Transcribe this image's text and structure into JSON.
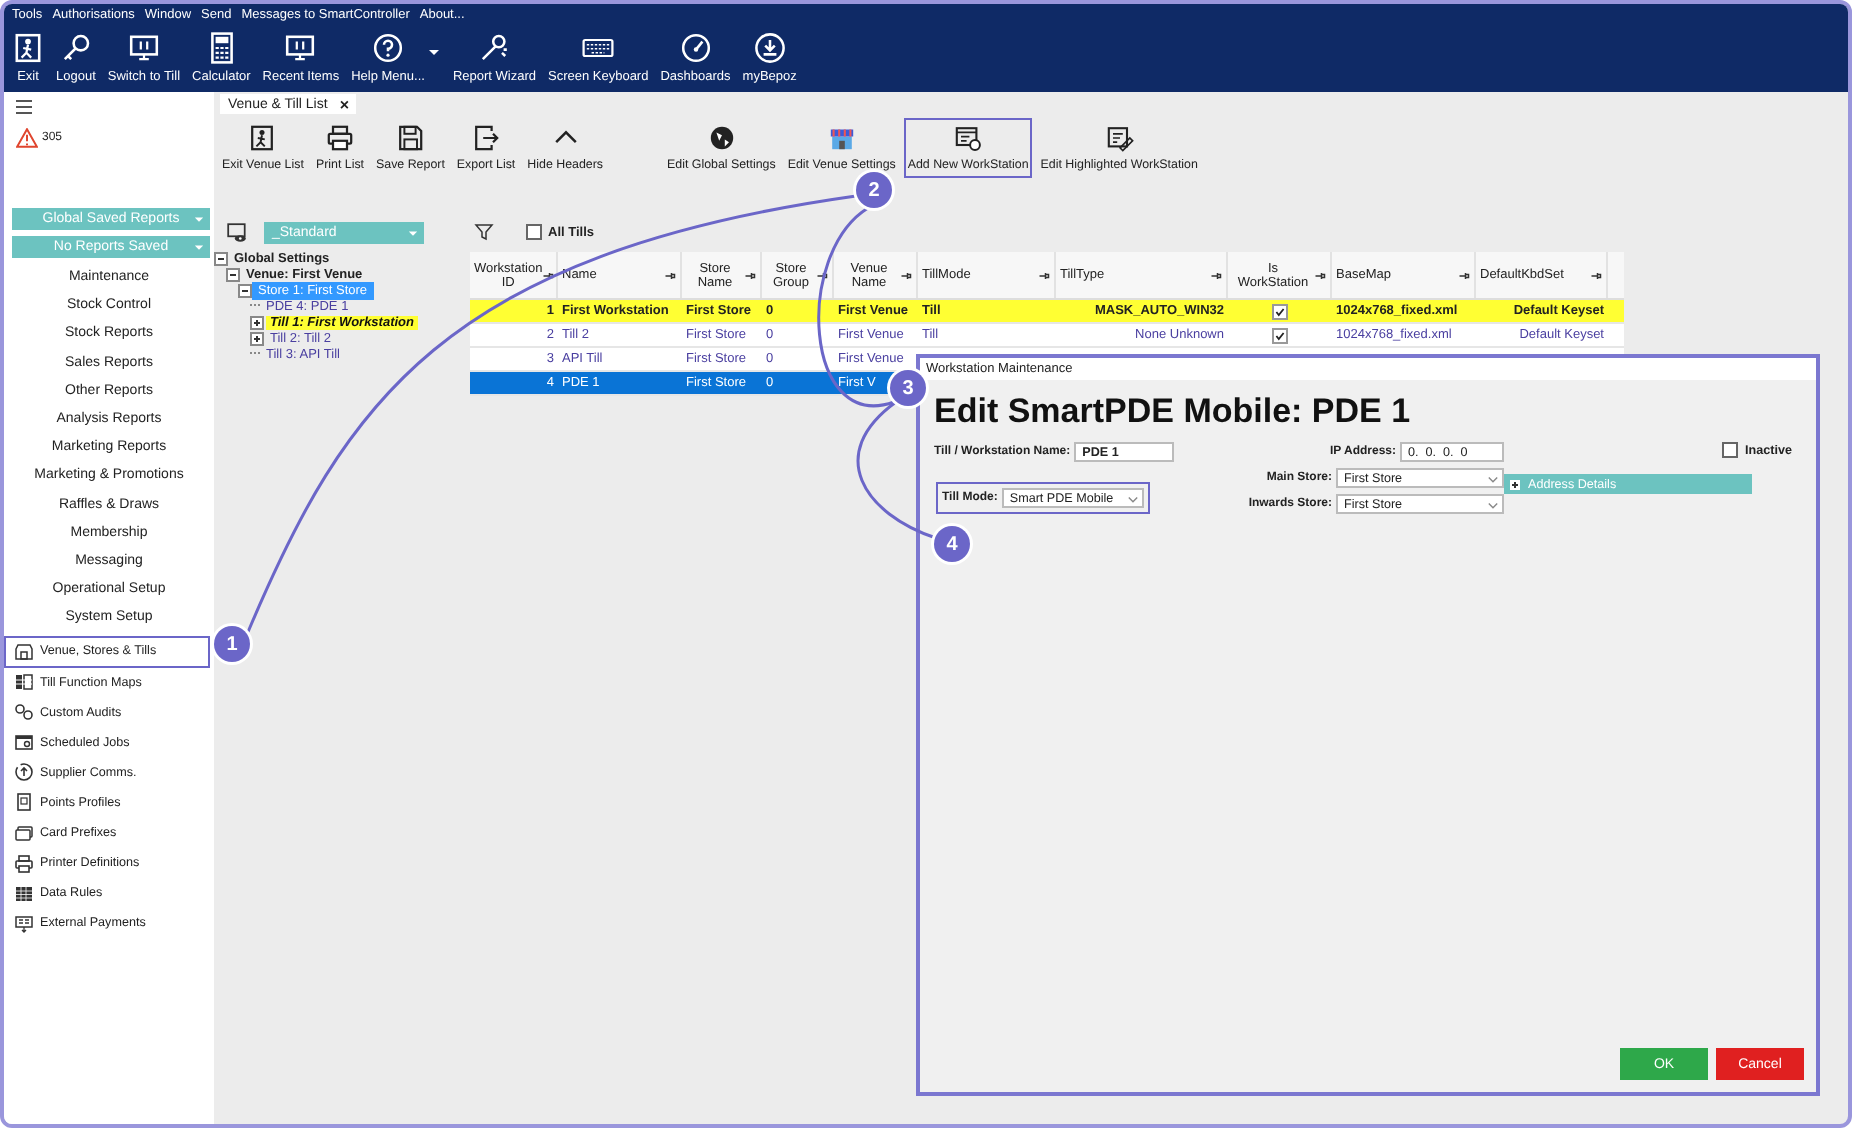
{
  "menu_bar": [
    "Tools",
    "Authorisations",
    "Window",
    "Send",
    "Messages to SmartController",
    "About..."
  ],
  "toolbar": [
    {
      "kind": "button",
      "label": "Exit"
    },
    {
      "kind": "button",
      "label": "Logout"
    },
    {
      "kind": "button",
      "label": "Switch to Till"
    },
    {
      "kind": "button",
      "label": "Calculator"
    },
    {
      "kind": "button",
      "label": "Recent Items"
    },
    {
      "kind": "button",
      "label": "Help Menu..."
    },
    {
      "kind": "caret"
    },
    {
      "kind": "button",
      "label": "Report Wizard"
    },
    {
      "kind": "button",
      "label": "Screen Keyboard"
    },
    {
      "kind": "button",
      "label": "Dashboards"
    },
    {
      "kind": "button",
      "label": "myBepoz"
    }
  ],
  "sidebar": {
    "alert_count": "305",
    "dropdowns": [
      "Global Saved Reports",
      "No Reports Saved"
    ],
    "menu": [
      "Maintenance",
      "Stock Control",
      "Stock Reports",
      "Sales Reports",
      "Other Reports",
      "Analysis Reports",
      "Marketing Reports",
      "Marketing & Promotions",
      "Raffles & Draws",
      "Membership",
      "Messaging",
      "Operational Setup",
      "System Setup"
    ],
    "items": [
      {
        "label": "Venue, Stores & Tills",
        "highlighted": true
      },
      {
        "label": "Till Function Maps",
        "highlighted": false
      },
      {
        "label": "Custom Audits",
        "highlighted": false
      },
      {
        "label": "Scheduled Jobs",
        "highlighted": false
      },
      {
        "label": "Supplier Comms.",
        "highlighted": false
      },
      {
        "label": "Points Profiles",
        "highlighted": false
      },
      {
        "label": "Card Prefixes",
        "highlighted": false
      },
      {
        "label": "Printer Definitions",
        "highlighted": false
      },
      {
        "label": "Data Rules",
        "highlighted": false
      },
      {
        "label": "External Payments",
        "highlighted": false
      }
    ]
  },
  "tab": {
    "label": "Venue & Till List",
    "close": "×"
  },
  "actions_left": [
    {
      "label": "Exit Venue List",
      "highlighted": false
    },
    {
      "label": "Print List",
      "highlighted": false
    },
    {
      "label": "Save Report",
      "highlighted": false
    },
    {
      "label": "Export List",
      "highlighted": false
    },
    {
      "label": "Hide Headers",
      "highlighted": false
    }
  ],
  "actions_right": [
    {
      "label": "Edit Global Settings",
      "highlighted": false
    },
    {
      "label": "Edit Venue Settings",
      "highlighted": false
    },
    {
      "label": "Add New WorkStation",
      "highlighted": true
    },
    {
      "label": "Edit Highlighted WorkStation",
      "highlighted": false
    }
  ],
  "view_select": "_Standard",
  "all_tills": {
    "label": "All Tills",
    "checked": false
  },
  "tree": [
    {
      "label": "Global Settings",
      "expanded": true,
      "selected": false,
      "highlighted": false,
      "children": [
        {
          "label": "Venue: First Venue",
          "expanded": true,
          "selected": false,
          "highlighted": false,
          "children": [
            {
              "label": "Store 1: First Store",
              "expanded": true,
              "selected": true,
              "highlighted": false,
              "children": [
                {
                  "label": "PDE 4: PDE 1",
                  "selected": false,
                  "highlighted": false
                },
                {
                  "label": "Till 1: First Workstation",
                  "expanded": false,
                  "selected": false,
                  "highlighted": true
                },
                {
                  "label": "Till 2: Till 2",
                  "expanded": false,
                  "selected": false,
                  "highlighted": false
                },
                {
                  "label": "Till 3: API Till",
                  "selected": false,
                  "highlighted": false
                }
              ]
            }
          ]
        }
      ]
    }
  ],
  "table": {
    "columns": [
      "Workstation ID",
      "Name",
      "Store Name",
      "Store Group",
      "Venue Name",
      "TillMode",
      "TillType",
      "Is WorkStation",
      "BaseMap",
      "DefaultKbdSet"
    ],
    "rows": [
      {
        "highlighted": true,
        "selected": false,
        "cells": [
          "1",
          "First Workstation",
          "First Store",
          "0",
          "First Venue",
          "Till",
          "MASK_AUTO_WIN32"
        ],
        "is_workstation": true,
        "tail": [
          "1024x768_fixed.xml",
          "Default Keyset"
        ]
      },
      {
        "highlighted": false,
        "selected": false,
        "cells": [
          "2",
          "Till 2",
          "First Store",
          "0",
          "First Venue",
          "Till",
          "None Unknown"
        ],
        "is_workstation": true,
        "tail": [
          "1024x768_fixed.xml",
          "Default Keyset"
        ]
      },
      {
        "highlighted": false,
        "selected": false,
        "cells": [
          "3",
          "API Till",
          "First Store",
          "0",
          "First Venue"
        ]
      },
      {
        "highlighted": false,
        "selected": true,
        "cells": [
          "4",
          "PDE 1",
          "First Store",
          "0",
          "First V"
        ]
      }
    ]
  },
  "dialog": {
    "title": "Workstation Maintenance",
    "heading": "Edit SmartPDE Mobile: PDE 1",
    "name": {
      "label": "Till / Workstation Name:",
      "value": "PDE 1"
    },
    "ip": {
      "label": "IP Address:",
      "value": "0.  0.  0.  0"
    },
    "inactive": {
      "label": "Inactive",
      "checked": false
    },
    "till_mode": {
      "label": "Till Mode:",
      "value": "Smart PDE Mobile",
      "highlighted": true
    },
    "main_store": {
      "label": "Main Store:",
      "value": "First Store"
    },
    "inwards_store": {
      "label": "Inwards Store:",
      "value": "First Store"
    },
    "address_details": {
      "label": "Address Details",
      "expanded": false
    },
    "buttons": [
      {
        "kind": "ok",
        "label": "OK"
      },
      {
        "kind": "cancel",
        "label": "Cancel"
      }
    ]
  },
  "callouts": [
    "1",
    "2",
    "3",
    "4"
  ]
}
